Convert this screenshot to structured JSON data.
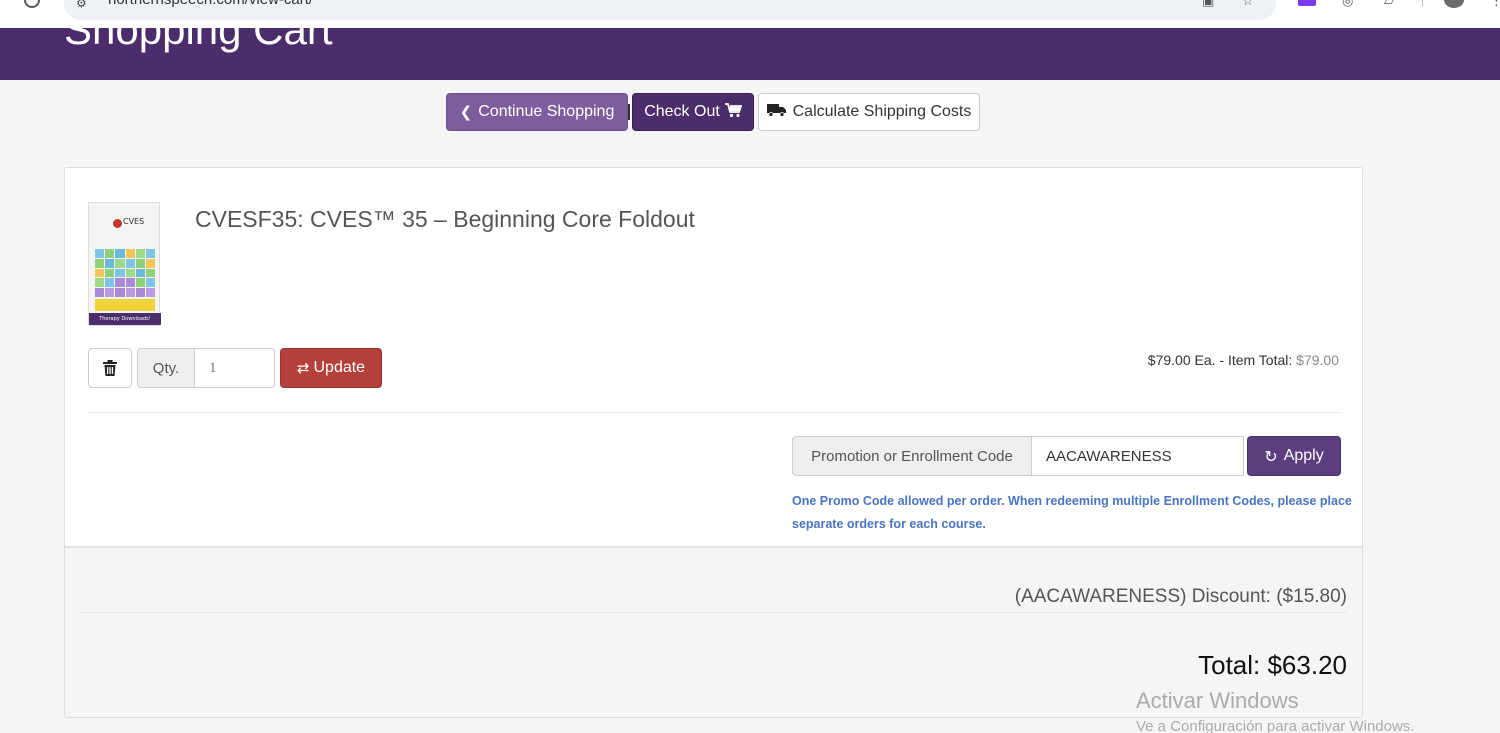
{
  "browser": {
    "url": "northernspeech.com/view-cart/"
  },
  "header": {
    "title": "Shopping Cart"
  },
  "actions": {
    "continue_label": "Continue Shopping",
    "checkout_label": "Check Out",
    "shipping_label": "Calculate Shipping Costs"
  },
  "cart": {
    "item": {
      "title": "CVESF35: CVES™ 35 – Beginning Core Foldout",
      "thumb_logo": "CVES",
      "thumb_footer": "Therapy Downloads!",
      "qty_label": "Qty.",
      "qty_value": "1",
      "update_label": "Update",
      "price_text": "$79.00 Ea. - Item Total: ",
      "item_total": "$79.00"
    },
    "promo": {
      "label": "Promotion or Enrollment Code",
      "value": "AACAWARENESS",
      "apply_label": "Apply",
      "note": "One Promo Code allowed per order. When redeeming multiple Enrollment Codes, please place separate orders for each course."
    },
    "discount_text": "(AACAWARENESS) Discount: ($15.80)",
    "total_text": "Total: $63.20"
  },
  "watermark": {
    "line1": "Activar Windows",
    "line2": "Ve a Configuración para activar Windows."
  },
  "icons": {
    "continue": "chevron-left-icon",
    "checkout": "shopping-cart-icon",
    "shipping": "truck-icon",
    "delete": "trash-icon",
    "update": "retweet-icon",
    "apply": "refresh-icon"
  },
  "colors": {
    "brand_purple": "#4c2d6b",
    "continue_purple": "#7d5d9e",
    "apply_purple": "#5b3f80",
    "update_red": "#b5403a",
    "note_blue": "#4a74c4"
  }
}
